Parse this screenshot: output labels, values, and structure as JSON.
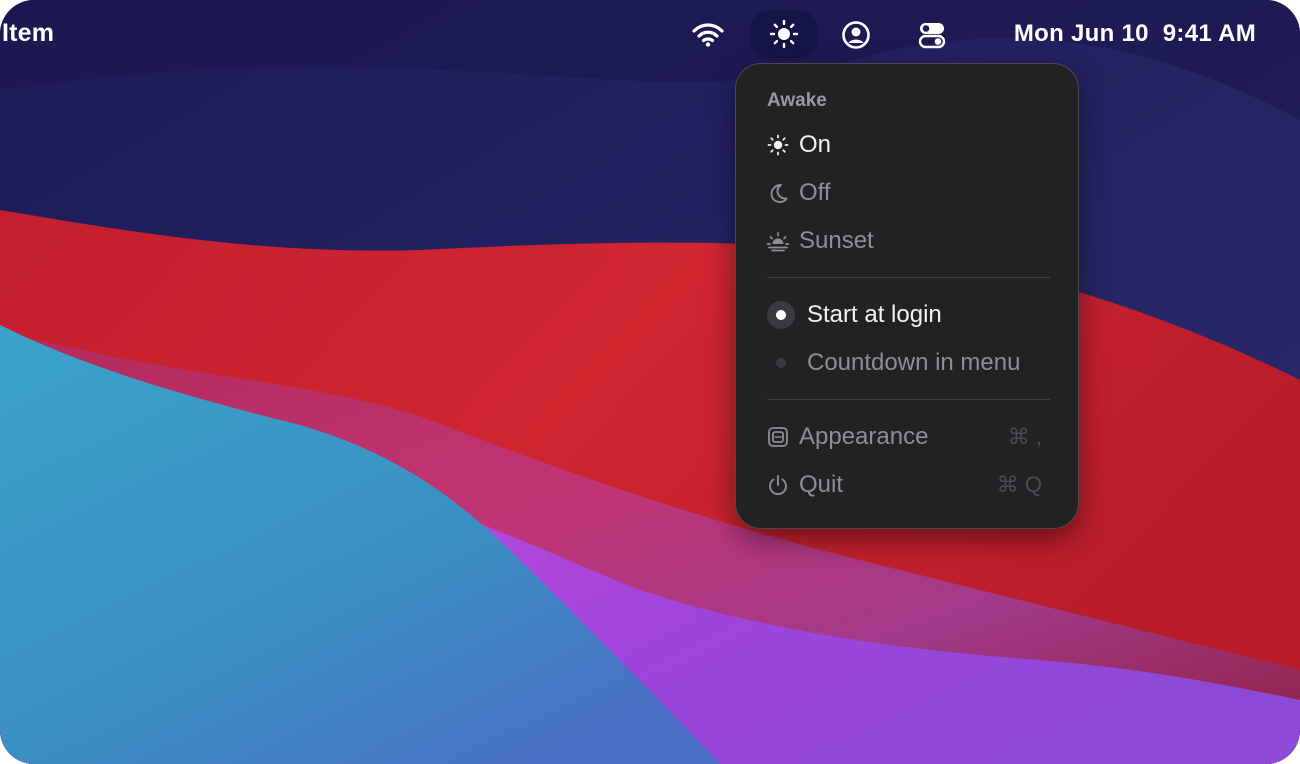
{
  "menubar": {
    "app_name": "Item",
    "icons": {
      "wifi": "wifi-icon",
      "awake": "sun-icon",
      "user": "user-circle-icon",
      "control_center": "control-center-icon"
    },
    "clock": "Mon Jun 10  9:41 AM"
  },
  "menu": {
    "header": "Awake",
    "modes": [
      {
        "label": "On",
        "icon": "sun-icon",
        "active": true
      },
      {
        "label": "Off",
        "icon": "moon-icon",
        "active": false
      },
      {
        "label": "Sunset",
        "icon": "sunset-icon",
        "active": false
      }
    ],
    "options": [
      {
        "label": "Start at login",
        "checked": true
      },
      {
        "label": "Countdown in menu",
        "checked": false
      }
    ],
    "actions": [
      {
        "label": "Appearance",
        "icon": "appearance-icon",
        "shortcut": "⌘ ,"
      },
      {
        "label": "Quit",
        "icon": "power-icon",
        "shortcut": "⌘ Q"
      }
    ]
  },
  "colors": {
    "menu_background": "#222224",
    "active_menubar_item": "#141447",
    "wallpaper_navy": "#262160",
    "wallpaper_red": "#c8202d",
    "wallpaper_blue": "#3a97c4",
    "wallpaper_purple": "#a845d6"
  }
}
